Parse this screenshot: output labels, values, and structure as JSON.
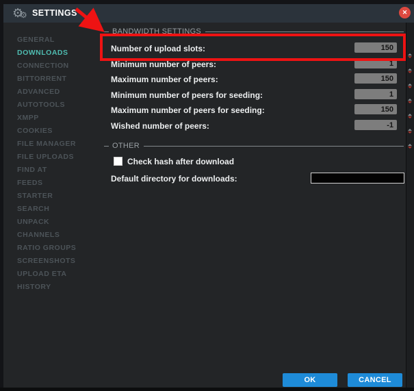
{
  "window": {
    "title": "SETTINGS",
    "close_glyph": "✕"
  },
  "sidebar": {
    "items": [
      {
        "label": "GENERAL",
        "selected": false
      },
      {
        "label": "DOWNLOADS",
        "selected": true
      },
      {
        "label": "CONNECTION",
        "selected": false
      },
      {
        "label": "BITTORRENT",
        "selected": false
      },
      {
        "label": "ADVANCED",
        "selected": false
      },
      {
        "label": "AUTOTOOLS",
        "selected": false
      },
      {
        "label": "XMPP",
        "selected": false
      },
      {
        "label": "COOKIES",
        "selected": false
      },
      {
        "label": "FILE MANAGER",
        "selected": false
      },
      {
        "label": "FILE UPLOADS",
        "selected": false
      },
      {
        "label": "FIND AT",
        "selected": false
      },
      {
        "label": "FEEDS",
        "selected": false
      },
      {
        "label": "STARTER",
        "selected": false
      },
      {
        "label": "SEARCH",
        "selected": false
      },
      {
        "label": "UNPACK",
        "selected": false
      },
      {
        "label": "CHANNELS",
        "selected": false
      },
      {
        "label": "RATIO GROUPS",
        "selected": false
      },
      {
        "label": "SCREENSHOTS",
        "selected": false
      },
      {
        "label": "UPLOAD ETA",
        "selected": false
      },
      {
        "label": "HISTORY",
        "selected": false
      }
    ]
  },
  "bandwidth": {
    "legend": "BANDWIDTH SETTINGS",
    "rows": [
      {
        "label": "Number of upload slots:",
        "value": "150"
      },
      {
        "label": "Minimum number of peers:",
        "value": "1"
      },
      {
        "label": "Maximum number of peers:",
        "value": "150"
      },
      {
        "label": "Minimum number of peers for seeding:",
        "value": "1"
      },
      {
        "label": "Maximum number of peers for seeding:",
        "value": "150"
      },
      {
        "label": "Wished number of peers:",
        "value": "-1"
      }
    ]
  },
  "other": {
    "legend": "OTHER",
    "checkbox_label": "Check hash after download",
    "checkbox_checked": false,
    "dir_label": "Default directory for downloads:",
    "dir_value": ""
  },
  "footer": {
    "ok": "OK",
    "cancel": "CANCEL"
  },
  "annotation": {
    "highlighted_row": "Number of upload slots:",
    "shape": "red arrow and red box"
  },
  "colors": {
    "accent_teal": "#4fbcb1",
    "button_blue": "#1e8bd8",
    "annotation_red": "#ee1313",
    "close_red": "#de4940",
    "input_gray": "#7d7d7d",
    "body_bg": "#232527",
    "titlebar_bg": "#2b333b"
  }
}
